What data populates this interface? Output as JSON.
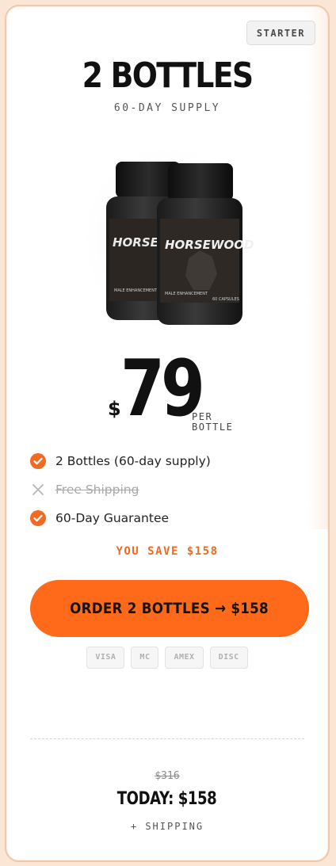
{
  "badge": "STARTER",
  "title": "2 BOTTLES",
  "subtitle": "60-DAY SUPPLY",
  "product": {
    "brand_label": "HORSEWOOD",
    "label_left": "MALE ENHANCEMENT",
    "label_right": "60 CAPSULES"
  },
  "price": {
    "currency": "$",
    "amount": "79",
    "per_line1": "PER",
    "per_line2": "BOTTLE"
  },
  "features": [
    {
      "label": "2 Bottles (60-day supply)",
      "included": true,
      "icon": "check-circle-icon"
    },
    {
      "label": "Free Shipping",
      "included": false,
      "icon": "x-icon"
    },
    {
      "label": "60-Day Guarantee",
      "included": true,
      "icon": "check-circle-icon"
    }
  ],
  "savings": "YOU SAVE $158",
  "cta_label": "ORDER 2 BOTTLES → $158",
  "payment_methods": [
    "VISA",
    "MC",
    "AMEX",
    "DISC"
  ],
  "summary": {
    "original_price": "$316",
    "today": "TODAY: $158",
    "shipping": "+ SHIPPING"
  },
  "colors": {
    "accent": "#ff6a1a",
    "accent_text": "#f26a21",
    "card_border": "#f1c7a6"
  }
}
